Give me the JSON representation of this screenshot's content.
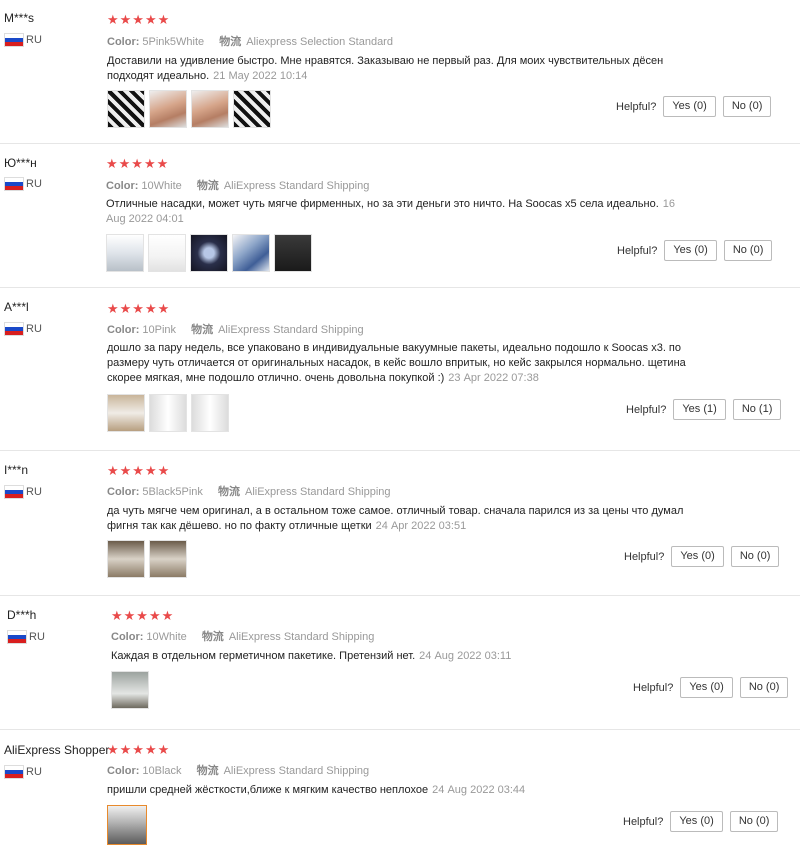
{
  "labels": {
    "color": "Color:",
    "shipping": "物流",
    "helpful": "Helpful?"
  },
  "stars": "★★★★★",
  "reviews": [
    {
      "user": "M***s",
      "country": "RU",
      "color": "5Pink5White",
      "shipping": "Aliexpress Selection Standard",
      "text": "Доставили на удивление быстро. Мне нравятся. Заказываю не первый раз. Для моих чувствительных дёсен подходят идеально.",
      "date": "21 May 2022 10:14",
      "yes": "Yes (0)",
      "no": "No (0)",
      "photos": [
        "zebra",
        "hand",
        "hand",
        "zebra"
      ]
    },
    {
      "user": "Ю***н",
      "country": "RU",
      "color": "10White",
      "shipping": "AliExpress Standard Shipping",
      "text": "Отличные насадки, может чуть мягче фирменных, но за эти деньги это ничто. На Soocas x5 села идеально.",
      "date": "16 Aug 2022 04:01",
      "yes": "Yes (0)",
      "no": "No (0)",
      "photos": [
        "pkg",
        "pkgw",
        "dark",
        "blu",
        "darkpkg"
      ]
    },
    {
      "user": "A***l",
      "country": "RU",
      "color": "10Pink",
      "shipping": "AliExpress Standard Shipping",
      "text": "дошло за пару недель, все упаковано в индивидуальные вакуумные пакеты, идеально подошло к Soocas x3. по размеру чуть отличается от оригинальных насадок, в кейс вошло впритык, но кейс закрылся нормально. щетина скорее мягкая, мне подошло отлично. очень довольна покупкой :)",
      "date": "23 Apr 2022 07:38",
      "yes": "Yes (1)",
      "no": "No (1)",
      "photos": [
        "tan",
        "wpkg",
        "wpkg"
      ]
    },
    {
      "user": "I***n",
      "country": "RU",
      "color": "5Black5Pink",
      "shipping": "AliExpress Standard Shipping",
      "text": "да чуть мягче чем оригинал, а в остальном тоже самое. отличный товар. сначала парился из за цены что думал фигня так как дёшево. но по факту отличные щетки",
      "date": "24 Apr 2022 03:51",
      "yes": "Yes (0)",
      "no": "No (0)",
      "photos": [
        "brownp",
        "brownp"
      ]
    },
    {
      "user": "D***h",
      "country": "RU",
      "color": "10White",
      "shipping": "AliExpress Standard Shipping",
      "text": "Каждая в отдельном герметичном пакетике. Претензий нет.",
      "date": "24 Aug 2022 03:11",
      "yes": "Yes (0)",
      "no": "No (0)",
      "photos": [
        "greyp"
      ]
    },
    {
      "user": "AliExpress Shopper",
      "country": "RU",
      "color": "10Black",
      "shipping": "AliExpress Standard Shipping",
      "text": "пришли средней жёсткости,ближе к мягким качество неплохое",
      "date": "24 Aug 2022 03:44",
      "yes": "Yes (0)",
      "no": "No (0)",
      "photos": [
        "mono"
      ]
    }
  ]
}
